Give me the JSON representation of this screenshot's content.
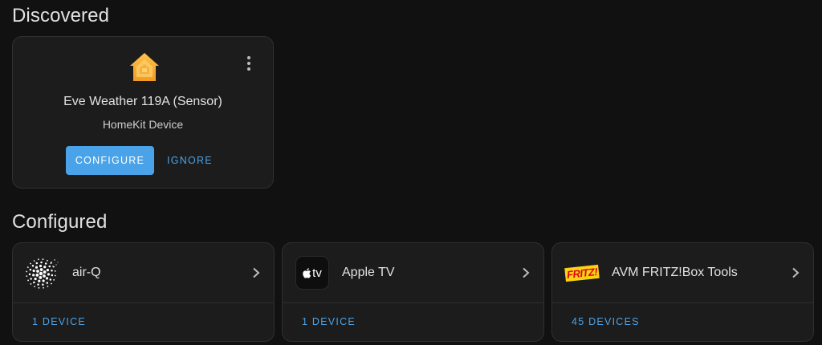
{
  "sections": {
    "discovered_title": "Discovered",
    "configured_title": "Configured"
  },
  "discovered": {
    "icon": "homekit-house-icon",
    "name": "Eve Weather 119A (Sensor)",
    "type": "HomeKit Device",
    "configure_label": "CONFIGURE",
    "ignore_label": "IGNORE"
  },
  "configured": [
    {
      "icon": "airq-dots-logo",
      "title": "air-Q",
      "footer": "1 DEVICE"
    },
    {
      "icon": "apple-tv-logo",
      "title": "Apple TV",
      "logo_text": "tv",
      "footer": "1 DEVICE"
    },
    {
      "icon": "fritz-logo",
      "title": "AVM FRITZ!Box Tools",
      "logo_text": "FRITZ!",
      "footer": "45 DEVICES"
    }
  ],
  "colors": {
    "background": "#111111",
    "card": "#1c1c1c",
    "accent": "#4aa3e8",
    "text": "#e1e1e1"
  }
}
